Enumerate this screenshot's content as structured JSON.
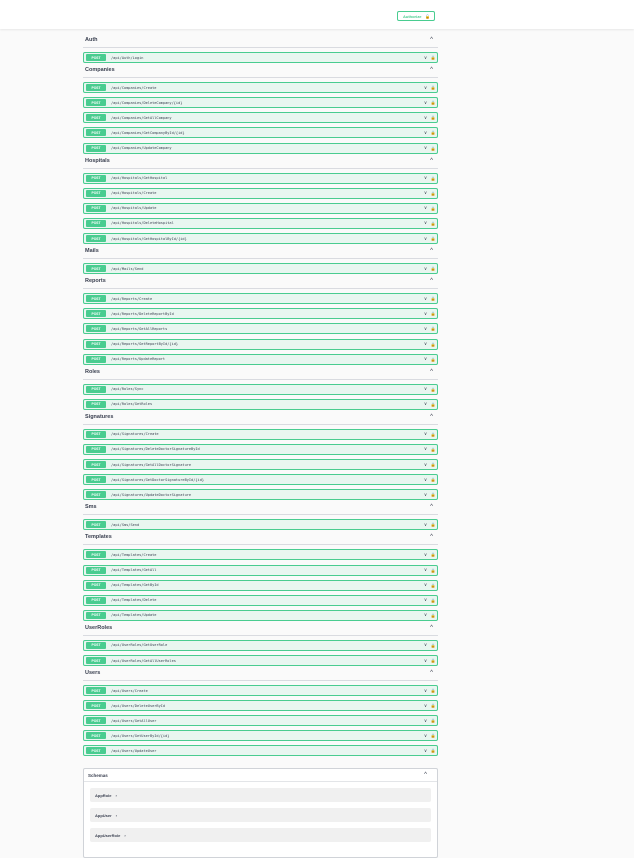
{
  "header": {
    "authorize_label": "Authorize",
    "lock_glyph": "🔓"
  },
  "method_label": "POST",
  "glyphs": {
    "collapse": "^",
    "expand": "∨",
    "lock": "🔒",
    "model_arrow": "›"
  },
  "tags": [
    {
      "name": "Auth",
      "ops": [
        "/api/Auth/Login"
      ]
    },
    {
      "name": "Companies",
      "ops": [
        "/api/Companies/Create",
        "/api/Companies/DeleteCompany/{id}",
        "/api/Companies/GetAllCompany",
        "/api/Companies/GetCompanyById/{id}",
        "/api/Companies/UpdateCompany"
      ]
    },
    {
      "name": "Hospitals",
      "ops": [
        "/api/Hospitals/GetHospital",
        "/api/Hospitals/Create",
        "/api/Hospitals/Update",
        "/api/Hospitals/DeleteHospital",
        "/api/Hospitals/GetHospitalById/{id}"
      ]
    },
    {
      "name": "Mails",
      "ops": [
        "/api/Mails/Send"
      ]
    },
    {
      "name": "Reports",
      "ops": [
        "/api/Reports/Create",
        "/api/Reports/DeleteReportById",
        "/api/Reports/GetAllReports",
        "/api/Reports/GetReportById/{id}",
        "/api/Reports/UpdateReport"
      ]
    },
    {
      "name": "Roles",
      "ops": [
        "/api/Roles/Sync",
        "/api/Roles/GetRoles"
      ]
    },
    {
      "name": "Signatures",
      "ops": [
        "/api/Signatures/Create",
        "/api/Signatures/DeleteDoctorSignatureById",
        "/api/Signatures/GetAllDoctorSignature",
        "/api/Signatures/GetDoctorSignatureById/{id}",
        "/api/Signatures/UpdateDoctorSignature"
      ]
    },
    {
      "name": "Sms",
      "ops": [
        "/api/Sms/Send"
      ]
    },
    {
      "name": "Templates",
      "ops": [
        "/api/Templates/Create",
        "/api/Templates/GetAll",
        "/api/Templates/GetById",
        "/api/Templates/Delete",
        "/api/Templates/Update"
      ]
    },
    {
      "name": "UserRoles",
      "ops": [
        "/api/UserRoles/GetUserRole",
        "/api/UserRoles/GetAllUserRoles"
      ]
    },
    {
      "name": "Users",
      "ops": [
        "/api/Users/Create",
        "/api/Users/DeleteUserById",
        "/api/Users/GetAllUser",
        "/api/Users/GetUserById/{id}",
        "/api/Users/UpdateUser"
      ]
    }
  ],
  "schemas": {
    "title": "Schemas",
    "models": [
      "AppRole",
      "AppUser",
      "AppUserRole"
    ]
  },
  "colors": {
    "post": "#49cc90",
    "post_bg": "#e8f6f0"
  }
}
